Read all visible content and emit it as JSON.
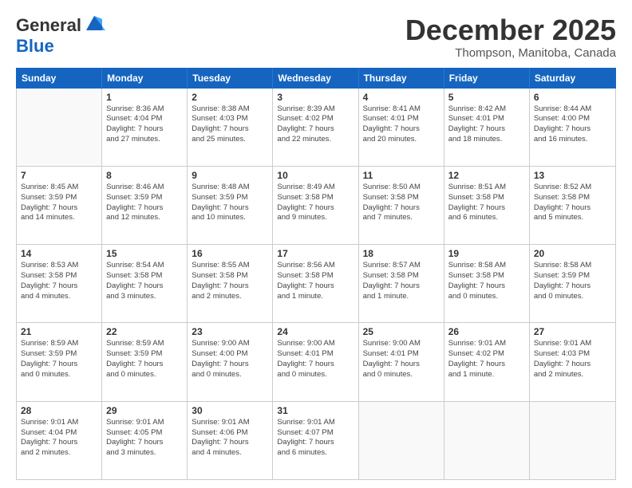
{
  "header": {
    "logo_general": "General",
    "logo_blue": "Blue",
    "month_title": "December 2025",
    "location": "Thompson, Manitoba, Canada"
  },
  "calendar": {
    "days_of_week": [
      "Sunday",
      "Monday",
      "Tuesday",
      "Wednesday",
      "Thursday",
      "Friday",
      "Saturday"
    ],
    "rows": [
      [
        {
          "day": "",
          "content": ""
        },
        {
          "day": "1",
          "content": "Sunrise: 8:36 AM\nSunset: 4:04 PM\nDaylight: 7 hours\nand 27 minutes."
        },
        {
          "day": "2",
          "content": "Sunrise: 8:38 AM\nSunset: 4:03 PM\nDaylight: 7 hours\nand 25 minutes."
        },
        {
          "day": "3",
          "content": "Sunrise: 8:39 AM\nSunset: 4:02 PM\nDaylight: 7 hours\nand 22 minutes."
        },
        {
          "day": "4",
          "content": "Sunrise: 8:41 AM\nSunset: 4:01 PM\nDaylight: 7 hours\nand 20 minutes."
        },
        {
          "day": "5",
          "content": "Sunrise: 8:42 AM\nSunset: 4:01 PM\nDaylight: 7 hours\nand 18 minutes."
        },
        {
          "day": "6",
          "content": "Sunrise: 8:44 AM\nSunset: 4:00 PM\nDaylight: 7 hours\nand 16 minutes."
        }
      ],
      [
        {
          "day": "7",
          "content": "Sunrise: 8:45 AM\nSunset: 3:59 PM\nDaylight: 7 hours\nand 14 minutes."
        },
        {
          "day": "8",
          "content": "Sunrise: 8:46 AM\nSunset: 3:59 PM\nDaylight: 7 hours\nand 12 minutes."
        },
        {
          "day": "9",
          "content": "Sunrise: 8:48 AM\nSunset: 3:59 PM\nDaylight: 7 hours\nand 10 minutes."
        },
        {
          "day": "10",
          "content": "Sunrise: 8:49 AM\nSunset: 3:58 PM\nDaylight: 7 hours\nand 9 minutes."
        },
        {
          "day": "11",
          "content": "Sunrise: 8:50 AM\nSunset: 3:58 PM\nDaylight: 7 hours\nand 7 minutes."
        },
        {
          "day": "12",
          "content": "Sunrise: 8:51 AM\nSunset: 3:58 PM\nDaylight: 7 hours\nand 6 minutes."
        },
        {
          "day": "13",
          "content": "Sunrise: 8:52 AM\nSunset: 3:58 PM\nDaylight: 7 hours\nand 5 minutes."
        }
      ],
      [
        {
          "day": "14",
          "content": "Sunrise: 8:53 AM\nSunset: 3:58 PM\nDaylight: 7 hours\nand 4 minutes."
        },
        {
          "day": "15",
          "content": "Sunrise: 8:54 AM\nSunset: 3:58 PM\nDaylight: 7 hours\nand 3 minutes."
        },
        {
          "day": "16",
          "content": "Sunrise: 8:55 AM\nSunset: 3:58 PM\nDaylight: 7 hours\nand 2 minutes."
        },
        {
          "day": "17",
          "content": "Sunrise: 8:56 AM\nSunset: 3:58 PM\nDaylight: 7 hours\nand 1 minute."
        },
        {
          "day": "18",
          "content": "Sunrise: 8:57 AM\nSunset: 3:58 PM\nDaylight: 7 hours\nand 1 minute."
        },
        {
          "day": "19",
          "content": "Sunrise: 8:58 AM\nSunset: 3:58 PM\nDaylight: 7 hours\nand 0 minutes."
        },
        {
          "day": "20",
          "content": "Sunrise: 8:58 AM\nSunset: 3:59 PM\nDaylight: 7 hours\nand 0 minutes."
        }
      ],
      [
        {
          "day": "21",
          "content": "Sunrise: 8:59 AM\nSunset: 3:59 PM\nDaylight: 7 hours\nand 0 minutes."
        },
        {
          "day": "22",
          "content": "Sunrise: 8:59 AM\nSunset: 3:59 PM\nDaylight: 7 hours\nand 0 minutes."
        },
        {
          "day": "23",
          "content": "Sunrise: 9:00 AM\nSunset: 4:00 PM\nDaylight: 7 hours\nand 0 minutes."
        },
        {
          "day": "24",
          "content": "Sunrise: 9:00 AM\nSunset: 4:01 PM\nDaylight: 7 hours\nand 0 minutes."
        },
        {
          "day": "25",
          "content": "Sunrise: 9:00 AM\nSunset: 4:01 PM\nDaylight: 7 hours\nand 0 minutes."
        },
        {
          "day": "26",
          "content": "Sunrise: 9:01 AM\nSunset: 4:02 PM\nDaylight: 7 hours\nand 1 minute."
        },
        {
          "day": "27",
          "content": "Sunrise: 9:01 AM\nSunset: 4:03 PM\nDaylight: 7 hours\nand 2 minutes."
        }
      ],
      [
        {
          "day": "28",
          "content": "Sunrise: 9:01 AM\nSunset: 4:04 PM\nDaylight: 7 hours\nand 2 minutes."
        },
        {
          "day": "29",
          "content": "Sunrise: 9:01 AM\nSunset: 4:05 PM\nDaylight: 7 hours\nand 3 minutes."
        },
        {
          "day": "30",
          "content": "Sunrise: 9:01 AM\nSunset: 4:06 PM\nDaylight: 7 hours\nand 4 minutes."
        },
        {
          "day": "31",
          "content": "Sunrise: 9:01 AM\nSunset: 4:07 PM\nDaylight: 7 hours\nand 6 minutes."
        },
        {
          "day": "",
          "content": ""
        },
        {
          "day": "",
          "content": ""
        },
        {
          "day": "",
          "content": ""
        }
      ]
    ]
  }
}
